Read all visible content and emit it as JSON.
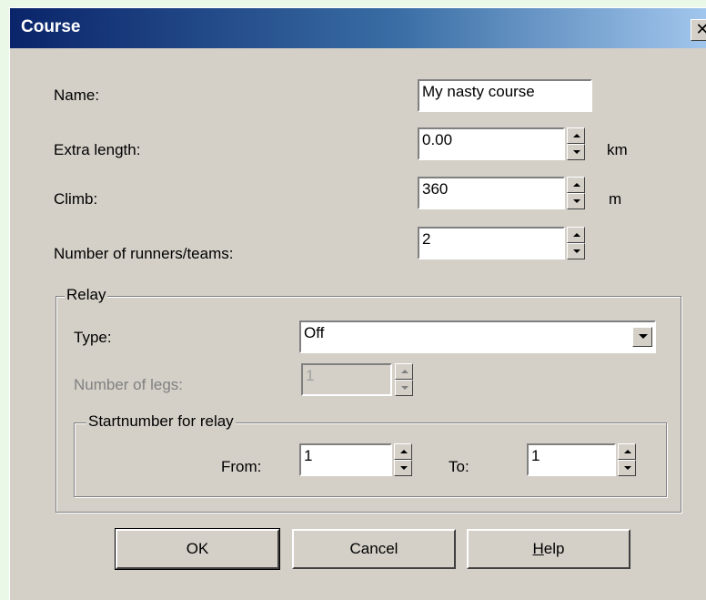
{
  "window": {
    "title": "Course",
    "close_glyph": "✕"
  },
  "fields": {
    "name": {
      "label": "Name:",
      "value": "My nasty course"
    },
    "extra_length": {
      "label": "Extra length:",
      "value": "0.00",
      "unit": "km"
    },
    "climb": {
      "label": "Climb:",
      "value": "360",
      "unit": "m"
    },
    "runners": {
      "label": "Number of runners/teams:",
      "value": "2"
    }
  },
  "relay": {
    "group_label": "Relay",
    "type": {
      "label": "Type:",
      "value": "Off"
    },
    "legs": {
      "label": "Number of legs:",
      "value": "1"
    },
    "startnumber": {
      "group_label": "Startnumber for relay",
      "from": {
        "label": "From:",
        "value": "1"
      },
      "to": {
        "label": "To:",
        "value": "1"
      }
    }
  },
  "buttons": {
    "ok": "OK",
    "cancel": "Cancel",
    "help_prefix": "",
    "help_accel": "H",
    "help_rest": "elp"
  },
  "icons": {
    "spin_up": "triangle-up-icon",
    "spin_down": "triangle-down-icon",
    "dropdown": "chevron-down-icon",
    "close": "close-icon"
  }
}
